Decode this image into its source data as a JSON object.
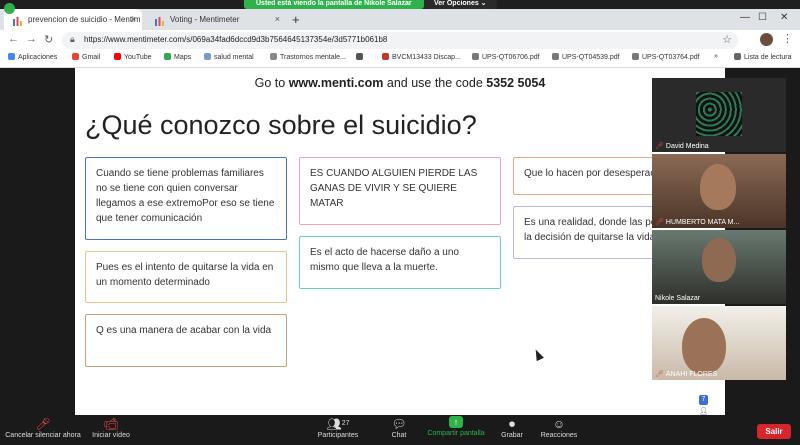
{
  "share_banner": {
    "message": "Usted está viendo la pantalla de Nikole Salazar",
    "options_label": "Ver Opciones ⌄"
  },
  "browser": {
    "tabs": [
      {
        "title": "prevencion de suicidio - Mentim",
        "close": "×"
      },
      {
        "title": "Voting - Mentimeter",
        "close": "×"
      }
    ],
    "new_tab": "+",
    "window_controls": [
      "—",
      "☐"
    ],
    "url": "https://www.mentimeter.com/s/069a34fad6dccd9d3b7564645137354e/3d5771b061b8",
    "bookmarks": [
      {
        "label": "Aplicaciones",
        "color": "#4285f4"
      },
      {
        "label": "Gmail",
        "color": "#ea4335"
      },
      {
        "label": "YouTube",
        "color": "#ff0000"
      },
      {
        "label": "Maps",
        "color": "#34a853"
      },
      {
        "label": "salud mental",
        "color": "#7a9cc6"
      },
      {
        "label": "Trastornos mentale...",
        "color": "#888888"
      },
      {
        "label": "",
        "color": "#555555"
      },
      {
        "label": "BVCM13433 Discap...",
        "color": "#c0392b"
      },
      {
        "label": "UPS-QT06706.pdf",
        "color": "#777777"
      },
      {
        "label": "UPS-QT04539.pdf",
        "color": "#777777"
      },
      {
        "label": "UPS-QT03764.pdf",
        "color": "#777777"
      },
      {
        "label": "»",
        "color": ""
      },
      {
        "label": "Lista de lectura",
        "color": "#666666"
      }
    ]
  },
  "slide": {
    "join_prefix": "Go to ",
    "join_site": "www.menti.com",
    "join_middle": " and use the code ",
    "join_code": "5352 5054",
    "question": "¿Qué conozco sobre el suicidio?",
    "responses": [
      "Cuando se tiene problemas familiares no se tiene con quien conversar llegamos a ese extremoPor eso se tiene que tener comunicación",
      "Pues es el intento de quitarse la vida en un momento determinado",
      "Q es una manera de acabar con la vida",
      "ES CUANDO ALGUIEN PIERDE LAS GANAS DE VIVIR Y SE QUIERE MATAR",
      "Es el acto de hacerse daño a uno mismo que lleva a la muerte.",
      "Que lo hacen por desesperación",
      "Es una realidad, donde las personas toman la decisión de quitarse la vida"
    ],
    "response_count": "7",
    "response_colors": {
      "blue": "#4a72c9",
      "peach": "#e8c58f",
      "tan": "#c8a07a",
      "pink": "#e8a8b2",
      "teal": "#6cd0b4",
      "coral": "#eca58a",
      "lav": "#b5b9ea"
    }
  },
  "participants_panel": [
    {
      "name": "David Medina",
      "muted": true
    },
    {
      "name": "HUMBERTO MATA M...",
      "muted": true
    },
    {
      "name": "Nikole Salazar",
      "muted": false
    },
    {
      "name": "ANAHI FLORES",
      "muted": true
    }
  ],
  "zoom_toolbar": {
    "unmute": "Cancelar silenciar ahora",
    "start_video": "Iniciar vídeo",
    "participants": "Participantes",
    "participants_count": "27",
    "chat": "Chat",
    "share": "Compartir pantalla",
    "record": "Grabar",
    "reactions": "Reacciones",
    "leave": "Salir"
  }
}
